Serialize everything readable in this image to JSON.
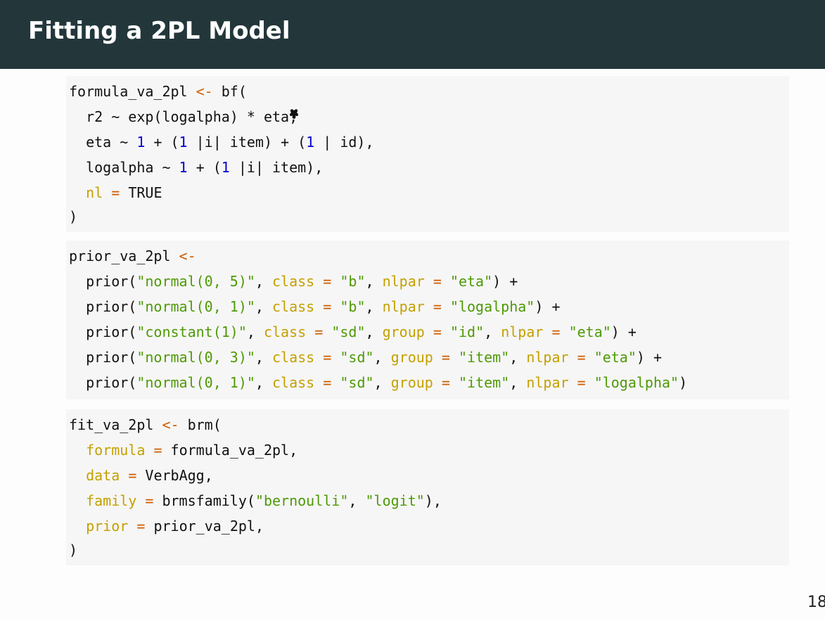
{
  "slide": {
    "title": "Fitting a 2PL Model",
    "page_number": "18"
  },
  "code_blocks": [
    {
      "lines": [
        [
          [
            "formula_va_2pl ",
            "plain"
          ],
          [
            "<-",
            "op"
          ],
          [
            " bf(",
            "plain"
          ]
        ],
        [
          [
            "  r2 ~ exp(logalpha) * eta,",
            "plain"
          ]
        ],
        [
          [
            "  eta ~ ",
            "plain"
          ],
          [
            "1",
            "num"
          ],
          [
            " + (",
            "plain"
          ],
          [
            "1",
            "num"
          ],
          [
            " |i| item) + (",
            "plain"
          ],
          [
            "1",
            "num"
          ],
          [
            " | id),",
            "plain"
          ]
        ],
        [
          [
            "  logalpha ~ ",
            "plain"
          ],
          [
            "1",
            "num"
          ],
          [
            " + (",
            "plain"
          ],
          [
            "1",
            "num"
          ],
          [
            " |i| item),",
            "plain"
          ]
        ],
        [
          [
            "  ",
            "plain"
          ],
          [
            "nl",
            "arg"
          ],
          [
            " ",
            "plain"
          ],
          [
            "=",
            "op"
          ],
          [
            " TRUE",
            "plain"
          ]
        ],
        [
          [
            ")",
            "plain"
          ]
        ]
      ]
    },
    {
      "lines": [
        [
          [
            "prior_va_2pl ",
            "plain"
          ],
          [
            "<-",
            "op"
          ]
        ],
        [
          [
            "  prior(",
            "plain"
          ],
          [
            "\"normal(0, 5)\"",
            "str"
          ],
          [
            ", ",
            "plain"
          ],
          [
            "class",
            "arg"
          ],
          [
            " ",
            "plain"
          ],
          [
            "=",
            "op"
          ],
          [
            " ",
            "plain"
          ],
          [
            "\"b\"",
            "str"
          ],
          [
            ", ",
            "plain"
          ],
          [
            "nlpar",
            "arg"
          ],
          [
            " ",
            "plain"
          ],
          [
            "=",
            "op"
          ],
          [
            " ",
            "plain"
          ],
          [
            "\"eta\"",
            "str"
          ],
          [
            ") +",
            "plain"
          ]
        ],
        [
          [
            "  prior(",
            "plain"
          ],
          [
            "\"normal(0, 1)\"",
            "str"
          ],
          [
            ", ",
            "plain"
          ],
          [
            "class",
            "arg"
          ],
          [
            " ",
            "plain"
          ],
          [
            "=",
            "op"
          ],
          [
            " ",
            "plain"
          ],
          [
            "\"b\"",
            "str"
          ],
          [
            ", ",
            "plain"
          ],
          [
            "nlpar",
            "arg"
          ],
          [
            " ",
            "plain"
          ],
          [
            "=",
            "op"
          ],
          [
            " ",
            "plain"
          ],
          [
            "\"logalpha\"",
            "str"
          ],
          [
            ") +",
            "plain"
          ]
        ],
        [
          [
            "  prior(",
            "plain"
          ],
          [
            "\"constant(1)\"",
            "str"
          ],
          [
            ", ",
            "plain"
          ],
          [
            "class",
            "arg"
          ],
          [
            " ",
            "plain"
          ],
          [
            "=",
            "op"
          ],
          [
            " ",
            "plain"
          ],
          [
            "\"sd\"",
            "str"
          ],
          [
            ", ",
            "plain"
          ],
          [
            "group",
            "arg"
          ],
          [
            " ",
            "plain"
          ],
          [
            "=",
            "op"
          ],
          [
            " ",
            "plain"
          ],
          [
            "\"id\"",
            "str"
          ],
          [
            ", ",
            "plain"
          ],
          [
            "nlpar",
            "arg"
          ],
          [
            " ",
            "plain"
          ],
          [
            "=",
            "op"
          ],
          [
            " ",
            "plain"
          ],
          [
            "\"eta\"",
            "str"
          ],
          [
            ") +",
            "plain"
          ]
        ],
        [
          [
            "  prior(",
            "plain"
          ],
          [
            "\"normal(0, 3)\"",
            "str"
          ],
          [
            ", ",
            "plain"
          ],
          [
            "class",
            "arg"
          ],
          [
            " ",
            "plain"
          ],
          [
            "=",
            "op"
          ],
          [
            " ",
            "plain"
          ],
          [
            "\"sd\"",
            "str"
          ],
          [
            ", ",
            "plain"
          ],
          [
            "group",
            "arg"
          ],
          [
            " ",
            "plain"
          ],
          [
            "=",
            "op"
          ],
          [
            " ",
            "plain"
          ],
          [
            "\"item\"",
            "str"
          ],
          [
            ", ",
            "plain"
          ],
          [
            "nlpar",
            "arg"
          ],
          [
            " ",
            "plain"
          ],
          [
            "=",
            "op"
          ],
          [
            " ",
            "plain"
          ],
          [
            "\"eta\"",
            "str"
          ],
          [
            ") +",
            "plain"
          ]
        ],
        [
          [
            "  prior(",
            "plain"
          ],
          [
            "\"normal(0, 1)\"",
            "str"
          ],
          [
            ", ",
            "plain"
          ],
          [
            "class",
            "arg"
          ],
          [
            " ",
            "plain"
          ],
          [
            "=",
            "op"
          ],
          [
            " ",
            "plain"
          ],
          [
            "\"sd\"",
            "str"
          ],
          [
            ", ",
            "plain"
          ],
          [
            "group",
            "arg"
          ],
          [
            " ",
            "plain"
          ],
          [
            "=",
            "op"
          ],
          [
            " ",
            "plain"
          ],
          [
            "\"item\"",
            "str"
          ],
          [
            ", ",
            "plain"
          ],
          [
            "nlpar",
            "arg"
          ],
          [
            " ",
            "plain"
          ],
          [
            "=",
            "op"
          ],
          [
            " ",
            "plain"
          ],
          [
            "\"logalpha\"",
            "str"
          ],
          [
            ")",
            "plain"
          ]
        ]
      ]
    },
    {
      "lines": [
        [
          [
            "fit_va_2pl ",
            "plain"
          ],
          [
            "<-",
            "op"
          ],
          [
            " brm(",
            "plain"
          ]
        ],
        [
          [
            "  ",
            "plain"
          ],
          [
            "formula",
            "arg"
          ],
          [
            " ",
            "plain"
          ],
          [
            "=",
            "op"
          ],
          [
            " formula_va_2pl,",
            "plain"
          ]
        ],
        [
          [
            "  ",
            "plain"
          ],
          [
            "data",
            "arg"
          ],
          [
            " ",
            "plain"
          ],
          [
            "=",
            "op"
          ],
          [
            " VerbAgg,",
            "plain"
          ]
        ],
        [
          [
            "  ",
            "plain"
          ],
          [
            "family",
            "arg"
          ],
          [
            " ",
            "plain"
          ],
          [
            "=",
            "op"
          ],
          [
            " brmsfamily(",
            "plain"
          ],
          [
            "\"bernoulli\"",
            "str"
          ],
          [
            ", ",
            "plain"
          ],
          [
            "\"logit\"",
            "str"
          ],
          [
            "),",
            "plain"
          ]
        ],
        [
          [
            "  ",
            "plain"
          ],
          [
            "prior",
            "arg"
          ],
          [
            " ",
            "plain"
          ],
          [
            "=",
            "op"
          ],
          [
            " prior_va_2pl,",
            "plain"
          ]
        ],
        [
          [
            ")",
            "plain"
          ]
        ]
      ]
    }
  ],
  "colors": {
    "title_bar": "#23373b",
    "title_text": "#ffffff",
    "code_background": "#f6f6f6",
    "plain": "#111111",
    "arg": "#c4a000",
    "num": "#0000cf",
    "str": "#4e9a06",
    "op": "#ce5c00"
  },
  "icons": {
    "cursor": "mouse-pointer-icon"
  }
}
